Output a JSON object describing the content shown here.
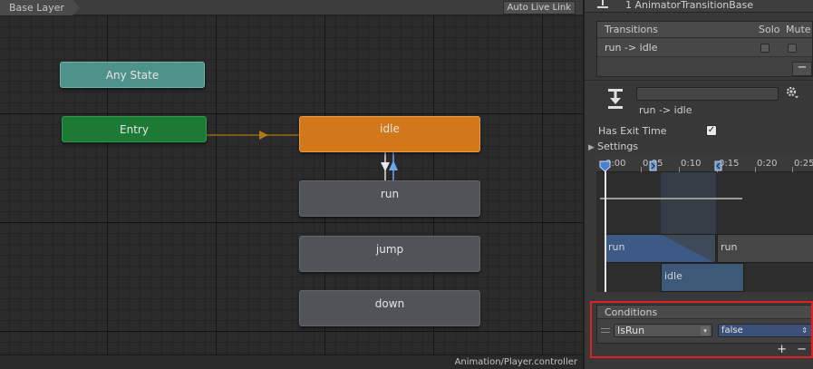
{
  "graph": {
    "breadcrumb": "Base Layer",
    "auto_live_link": "Auto Live Link",
    "states": {
      "any_state": "Any State",
      "entry": "Entry",
      "idle": "idle",
      "run": "run",
      "jump": "jump",
      "down": "down"
    },
    "controller_path": "Animation/Player.controller"
  },
  "inspector": {
    "title": "1 AnimatorTransitionBase",
    "transitions_list": {
      "header": "Transitions",
      "solo": "Solo",
      "mute": "Mute",
      "rows": [
        {
          "label": "run -> idle"
        }
      ],
      "remove_label": "−"
    },
    "transition": {
      "name_value": "",
      "label": "run -> idle"
    },
    "has_exit_time": {
      "label": "Has Exit Time",
      "checked": true,
      "check_glyph": "✓"
    },
    "settings": {
      "label": "Settings",
      "arrow": "▶"
    },
    "timeline": {
      "ticks": [
        "0:00",
        "0:05",
        "0:10",
        "0:15",
        "0:20",
        "0:25"
      ],
      "clips": {
        "run_a": "run",
        "run_b": "run",
        "idle": "idle"
      }
    },
    "conditions": {
      "title": "Conditions",
      "parameter": "IsRun",
      "parameter_arrow": "▾",
      "value": "false",
      "value_arrow": "⇕",
      "add_label": "+",
      "remove_label": "−"
    }
  },
  "colors": {
    "any_state": "#4f9289",
    "entry": "#1c7a34",
    "idle_default": "#d2781a",
    "state_gray": "#505357",
    "highlight_box": "#e02020",
    "selection_blue": "#3b5179"
  }
}
